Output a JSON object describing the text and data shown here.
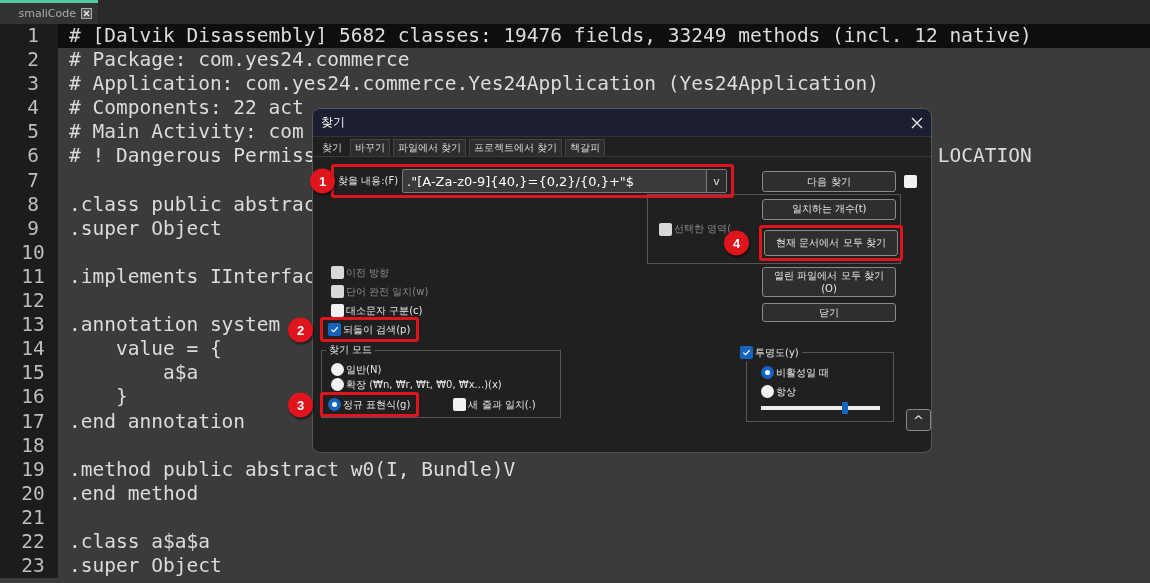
{
  "editor_tab": {
    "title": "smaliCode",
    "selected": true
  },
  "lines": [
    {
      "number": "1",
      "text": "# [Dalvik Disassembly] 5682 classes: 19476 fields, 33249 methods (incl. 12 native)",
      "current": true
    },
    {
      "number": "2",
      "text": "# Package: com.yes24.commerce",
      "current": false
    },
    {
      "number": "3",
      "text": "# Application: com.yes24.commerce.Yes24Application (Yes24Application)",
      "current": false
    },
    {
      "number": "4",
      "text": "# Components: 22 act",
      "current": false
    },
    {
      "number": "5",
      "text": "# Main Activity: com",
      "current": false
    },
    {
      "number": "6",
      "text": "# ! Dangerous Permiss",
      "tail": "LOCATION",
      "current": false
    },
    {
      "number": "7",
      "current": false
    },
    {
      "number": "8",
      "text": ".class public abstrac",
      "current": false
    },
    {
      "number": "9",
      "text": ".super Object",
      "current": false
    },
    {
      "number": "10",
      "current": false
    },
    {
      "number": "11",
      "text": ".implements IInterfac",
      "current": false
    },
    {
      "number": "12",
      "current": false
    },
    {
      "number": "13",
      "text": ".annotation system",
      "current": false
    },
    {
      "number": "14",
      "text": "    value = {",
      "current": false
    },
    {
      "number": "15",
      "text": "        a$a",
      "current": false
    },
    {
      "number": "16",
      "text": "    }",
      "current": false
    },
    {
      "number": "17",
      "text": ".end annotation",
      "current": false
    },
    {
      "number": "18",
      "current": false
    },
    {
      "number": "19",
      "text": ".method public abstract w0(I, Bundle)V",
      "current": false
    },
    {
      "number": "20",
      "text": ".end method",
      "current": false
    },
    {
      "number": "21",
      "current": false
    },
    {
      "number": "22",
      "text": ".class a$a$a",
      "current": false
    },
    {
      "number": "23",
      "text": ".super Object",
      "current": false
    }
  ],
  "dialog": {
    "title": "찾기",
    "tabs": [
      {
        "label": "찾기",
        "selected": true
      },
      {
        "label": "바꾸기",
        "selected": false
      },
      {
        "label": "파일에서 찾기",
        "selected": false
      },
      {
        "label": "프로젝트에서 찾기",
        "selected": false
      },
      {
        "label": "책갈피",
        "selected": false
      }
    ],
    "find": {
      "label": "찾을 내용:(F)",
      "value": ".\"[A-Za-z0-9]{40,}={0,2}/{0,}+\"$",
      "dropdown": "v",
      "badge": "1"
    },
    "options": [
      {
        "label": "이전 방향",
        "checked": false,
        "disabled": true
      },
      {
        "label": "단어 완전 일치(w)",
        "checked": false,
        "disabled": true
      },
      {
        "label": "대소문자 구분(c)",
        "checked": false,
        "disabled": false
      },
      {
        "label": "되돌이 검색(p)",
        "checked": true,
        "disabled": false,
        "badge": "2"
      }
    ],
    "mode": {
      "title": "찾기 모드",
      "options": [
        {
          "label": "일반(N)",
          "selected": false
        },
        {
          "label": "확장 (₩n, ₩r, ₩t, ₩0, ₩x...)(x)",
          "selected": false
        },
        {
          "label": "정규 표현식(g)",
          "selected": true,
          "badge": "3"
        }
      ],
      "newline": {
        "label": "새 줄과 일치(.)",
        "checked": false
      }
    },
    "selection": {
      "label": "선택한 영역(",
      "checked": false,
      "disabled": true
    },
    "next_checkbox": {
      "checked": false
    },
    "buttons": [
      {
        "label": "다음 찾기"
      },
      {
        "label": "일치하는 개수(t)"
      },
      {
        "label": "현재 문서에서 모두 찾기",
        "badge": "4"
      },
      {
        "label": "열린 파일에서 모두 찾기(O)"
      },
      {
        "label": "닫기"
      }
    ],
    "transparency": {
      "label": "투명도(y)",
      "checked": true,
      "options": [
        {
          "label": "비활성일 때",
          "selected": true
        },
        {
          "label": "항상",
          "selected": false
        }
      ],
      "level": 0.71
    },
    "collapse": "^"
  }
}
